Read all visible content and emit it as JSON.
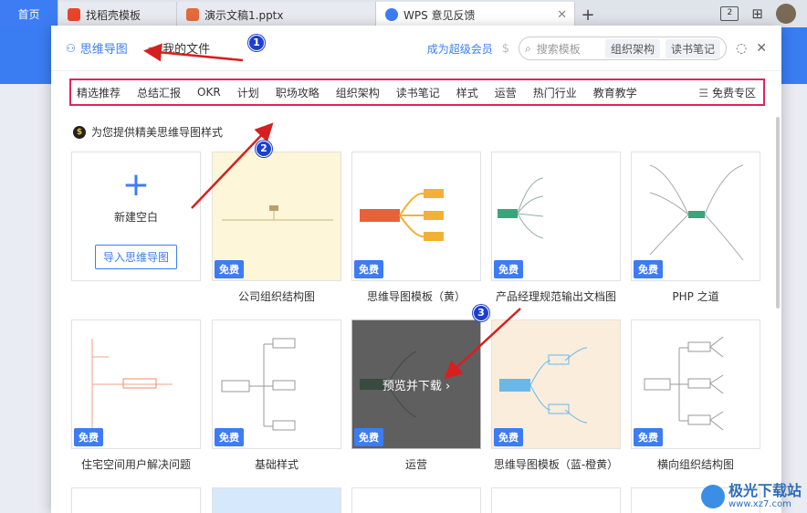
{
  "tabs": {
    "home": "首页",
    "tab1": "找稻壳模板",
    "tab2": "演示文稿1.pptx",
    "tab3": "WPS 意见反馈",
    "close": "✕",
    "new": "+",
    "screens_badge": "2"
  },
  "dialog": {
    "tab_mindmap": "思维导图",
    "tab_myfiles": "我的文件",
    "vip": "成为超级会员",
    "search_placeholder": "搜索模板",
    "search_chip1": "组织架构",
    "search_chip2": "读书笔记",
    "close": "✕"
  },
  "categories": [
    "精选推荐",
    "总结汇报",
    "OKR",
    "计划",
    "职场攻略",
    "组织架构",
    "读书笔记",
    "样式",
    "运营",
    "热门行业",
    "教育教学"
  ],
  "free_zone": "免费专区",
  "section_title": "为您提供精美思维导图样式",
  "new_blank": "新建空白",
  "import_btn": "导入思维导图",
  "free_badge": "免费",
  "preview_label": "预览并下载 ›",
  "cards": [
    "公司组织结构图",
    "思维导图模板（黄）",
    "产品经理规范输出文档图",
    "PHP 之道",
    "住宅空间用户解决问题",
    "基础样式",
    "运营",
    "思维导图模板（蓝-橙黄）",
    "横向组织结构图"
  ],
  "annotations": [
    "1",
    "2",
    "3"
  ],
  "watermark": {
    "name": "极光下载站",
    "url": "www.xz7.com"
  },
  "colors": {
    "accent": "#3d7cf3",
    "highlight_border": "#e0245e",
    "arrow": "#d6201f"
  }
}
